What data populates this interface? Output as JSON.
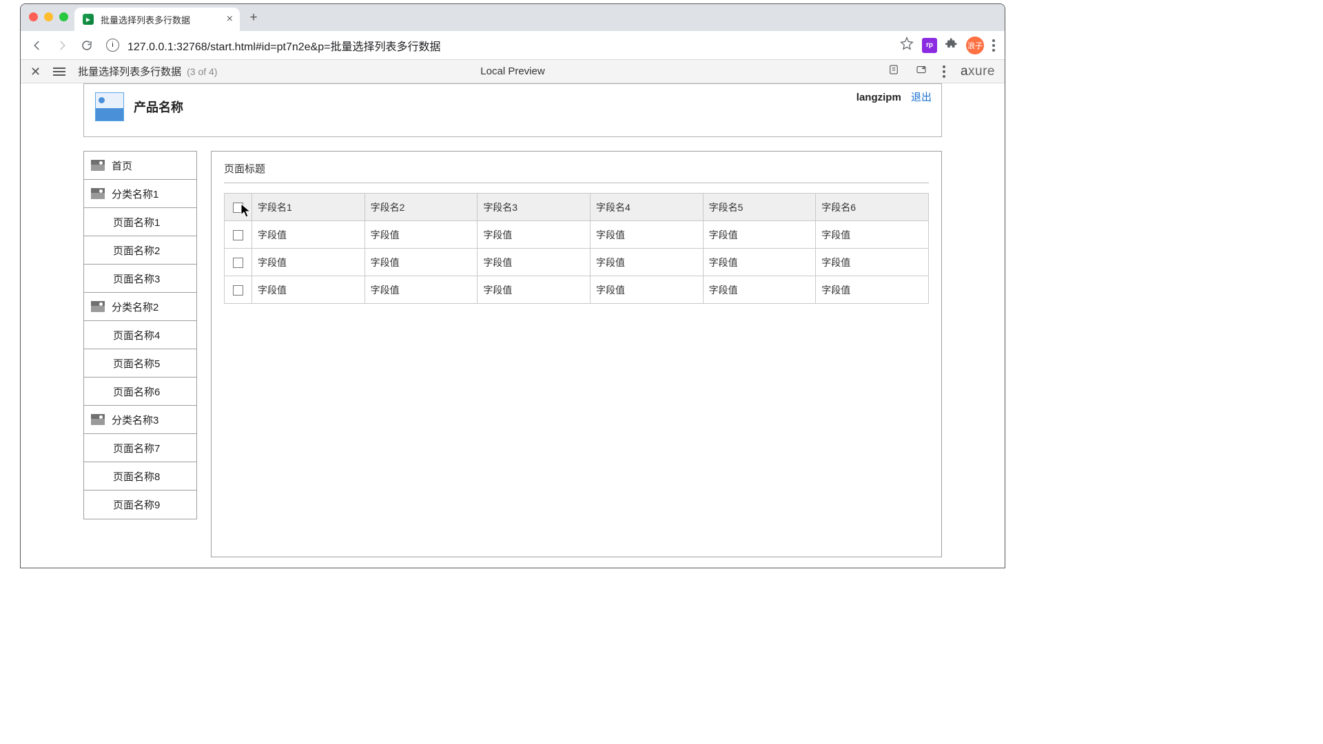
{
  "browser": {
    "tab_title": "批量选择列表多行数据",
    "url": "127.0.0.1:32768/start.html#id=pt7n2e&p=批量选择列表多行数据"
  },
  "axure": {
    "page_name": "批量选择列表多行数据",
    "count": "(3 of 4)",
    "center": "Local Preview",
    "logo_a": "a",
    "logo_rest": "xure"
  },
  "header": {
    "product_name": "产品名称",
    "user": "langzipm",
    "logout": "退出"
  },
  "sidebar": {
    "home": "首页",
    "cat1": "分类名称1",
    "cat2": "分类名称2",
    "cat3": "分类名称3",
    "p1": "页面名称1",
    "p2": "页面名称2",
    "p3": "页面名称3",
    "p4": "页面名称4",
    "p5": "页面名称5",
    "p6": "页面名称6",
    "p7": "页面名称7",
    "p8": "页面名称8",
    "p9": "页面名称9"
  },
  "panel": {
    "title": "页面标题",
    "headers": {
      "h1": "字段名1",
      "h2": "字段名2",
      "h3": "字段名3",
      "h4": "字段名4",
      "h5": "字段名5",
      "h6": "字段名6"
    },
    "cell": "字段值"
  },
  "ext_label": "rp",
  "avatar_label": "浪子"
}
